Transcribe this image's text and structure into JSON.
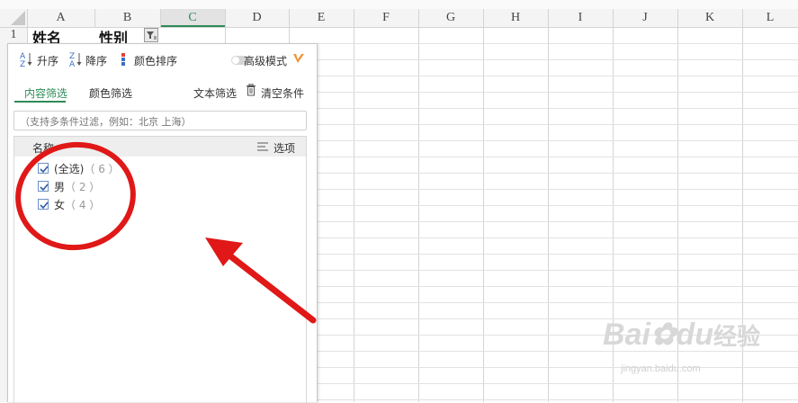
{
  "sheet": {
    "columns": [
      "A",
      "B",
      "C",
      "D",
      "E",
      "F",
      "G",
      "H",
      "I",
      "J",
      "K",
      "L"
    ],
    "row_numbers": [
      "1"
    ],
    "cells": {
      "A1": "姓名",
      "B1": "性别"
    }
  },
  "filter_panel": {
    "sort_asc": "升序",
    "sort_desc": "降序",
    "sort_color": "颜色排序",
    "advanced_mode": "高级模式",
    "tab_content": "内容筛选",
    "tab_color": "颜色筛选",
    "text_filter": "文本筛选",
    "clear_conditions": "清空条件",
    "search_placeholder": "（支持多条件过滤，例如：北京 上海）",
    "list_header": "名称",
    "options_label": "选项",
    "items": [
      {
        "label": "(全选)",
        "count": "（ 6 ）"
      },
      {
        "label": "男",
        "count": "（ 2 ）"
      },
      {
        "label": "女",
        "count": "（ 4 ）"
      }
    ]
  },
  "watermark": {
    "brand": "Bai",
    "brand2": "du",
    "cn": "经验",
    "url": "jingyan.baidu.com"
  },
  "colors": {
    "accent_green": "#2e8b57",
    "annotation_red": "#e01818"
  }
}
